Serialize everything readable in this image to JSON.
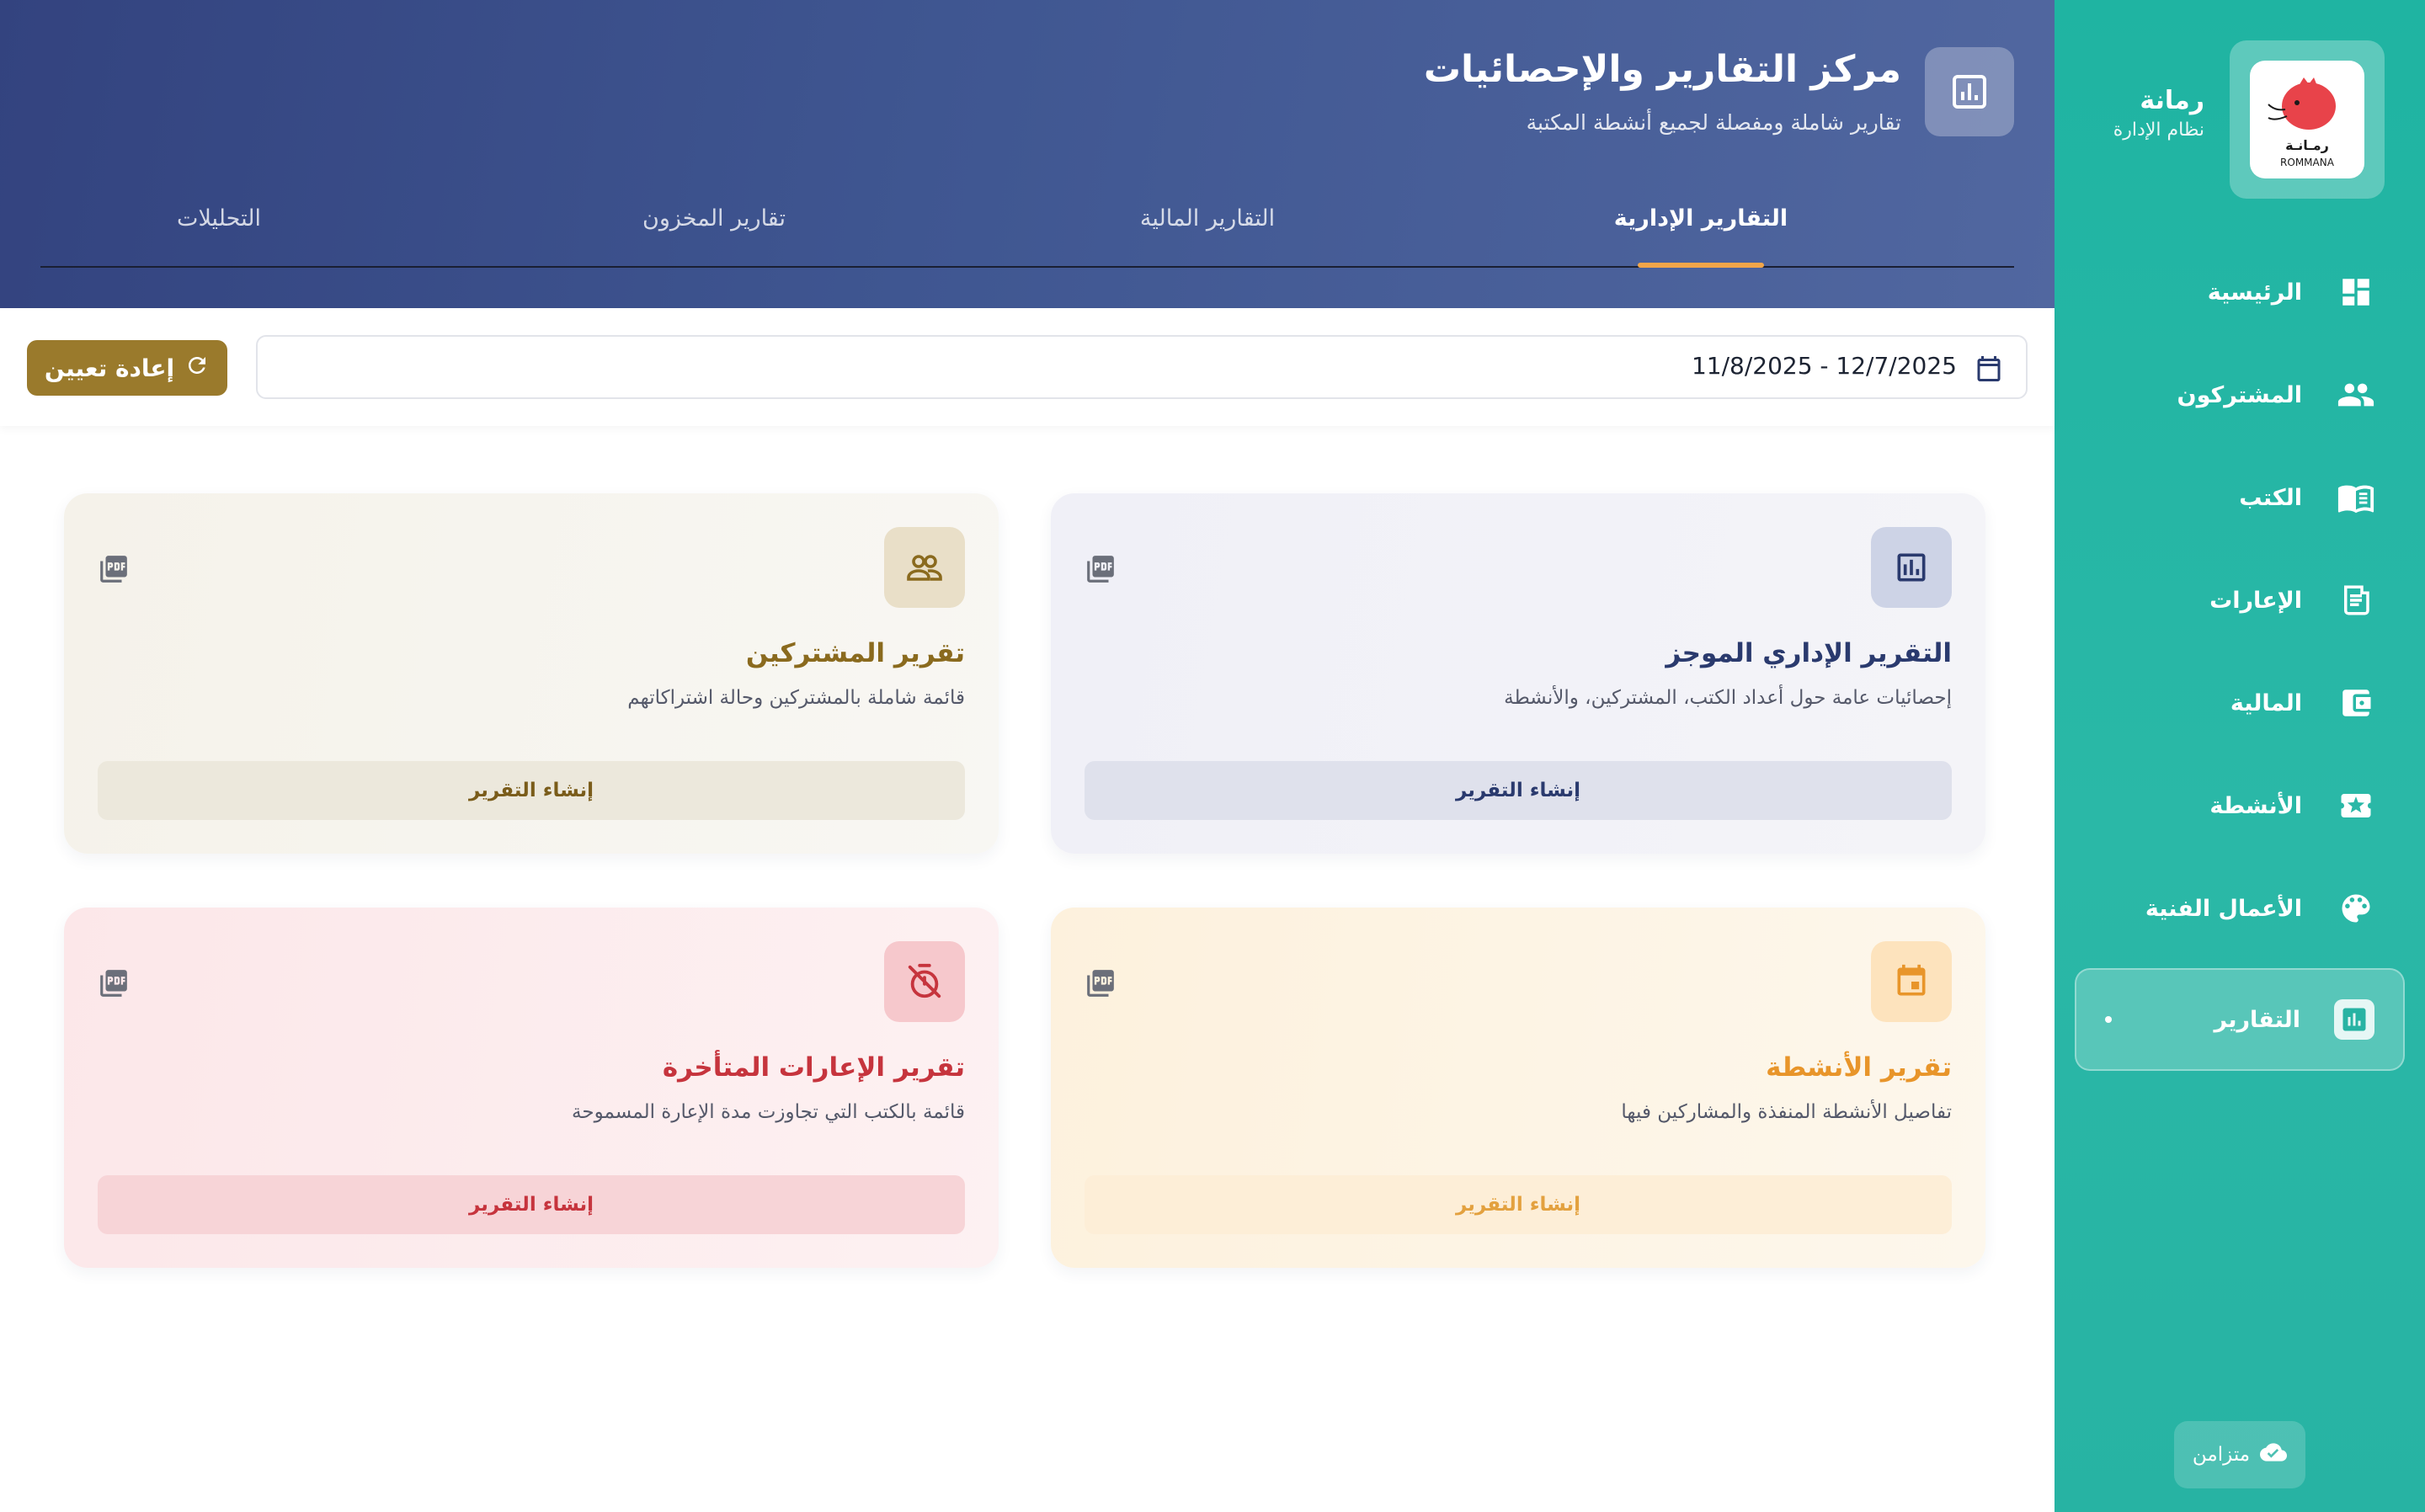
{
  "sidebar": {
    "brand_name": "رمانة",
    "brand_sub": "نظام الإدارة",
    "logo_text": "ROMMANA",
    "items": [
      {
        "label": "الرئيسية",
        "icon": "dashboard-icon"
      },
      {
        "label": "المشتركون",
        "icon": "people-icon"
      },
      {
        "label": "الكتب",
        "icon": "book-icon"
      },
      {
        "label": "الإعارات",
        "icon": "receipt-icon"
      },
      {
        "label": "المالية",
        "icon": "wallet-icon"
      },
      {
        "label": "الأنشطة",
        "icon": "star-ticket-icon"
      },
      {
        "label": "الأعمال الفنية",
        "icon": "palette-icon"
      },
      {
        "label": "التقارير",
        "icon": "chart-icon",
        "active": true
      }
    ],
    "sync_label": "متزامن"
  },
  "header": {
    "title": "مركز التقارير والإحصائيات",
    "subtitle": "تقارير شاملة ومفصلة لجميع أنشطة المكتبة",
    "tabs": [
      {
        "label": "التقارير الإدارية",
        "active": true
      },
      {
        "label": "التقارير المالية"
      },
      {
        "label": "تقارير المخزون"
      },
      {
        "label": "التحليلات"
      }
    ]
  },
  "filter": {
    "date_range": "11/8/2025 - 12/7/2025",
    "reset_label": "إعادة تعيين"
  },
  "cards": [
    {
      "title": "التقرير الإداري الموجز",
      "desc": "إحصائيات عامة حول أعداد الكتب، المشتركين، والأنشطة",
      "button": "إنشاء التقرير"
    },
    {
      "title": "تقرير المشتركين",
      "desc": "قائمة شاملة بالمشتركين وحالة اشتراكاتهم",
      "button": "إنشاء التقرير"
    },
    {
      "title": "تقرير الأنشطة",
      "desc": "تفاصيل الأنشطة المنفذة والمشاركين فيها",
      "button": "إنشاء التقرير"
    },
    {
      "title": "تقرير الإعارات المتأخرة",
      "desc": "قائمة بالكتب التي تجاوزت مدة الإعارة المسموحة",
      "button": "إنشاء التقرير"
    }
  ],
  "colors": {
    "sidebar": "#27b3a3",
    "header": "#3f5691",
    "tab_accent": "#f2a649",
    "reset_button": "#9a7a2c"
  }
}
